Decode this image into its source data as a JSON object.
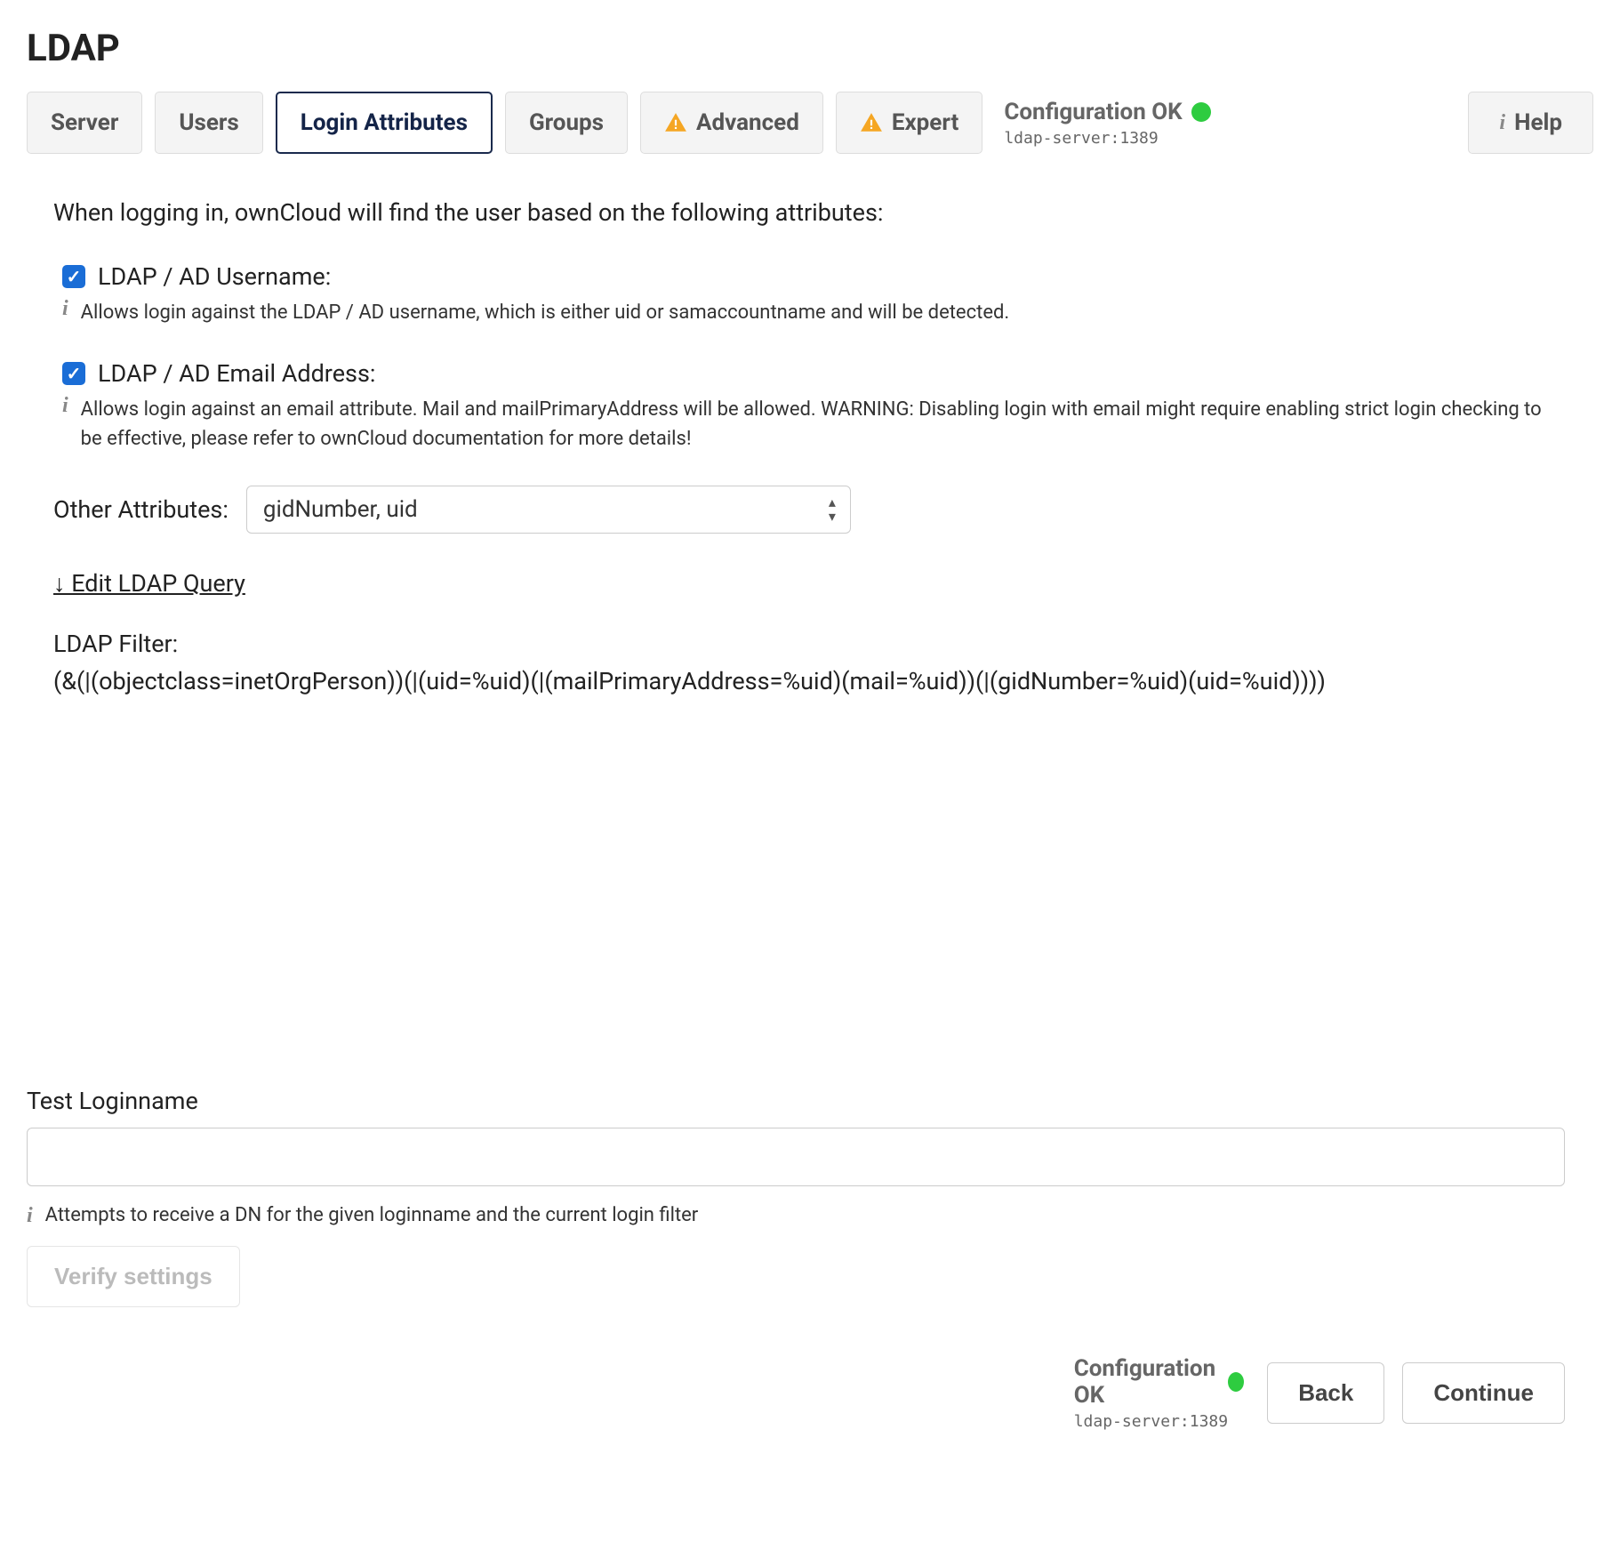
{
  "page_title": "LDAP",
  "tabs": {
    "server": "Server",
    "users": "Users",
    "login_attributes": "Login Attributes",
    "groups": "Groups",
    "advanced": "Advanced",
    "expert": "Expert"
  },
  "status": {
    "label": "Configuration OK",
    "detail": "ldap-server:1389"
  },
  "help_label": "Help",
  "intro": "When logging in, ownCloud will find the user based on the following attributes:",
  "username_check": {
    "label": "LDAP / AD Username:",
    "help": "Allows login against the LDAP / AD username, which is either uid or samaccountname and will be detected."
  },
  "email_check": {
    "label": "LDAP / AD Email Address:",
    "help": "Allows login against an email attribute. Mail and mailPrimaryAddress will be allowed. WARNING: Disabling login with email might require enabling strict login checking to be effective, please refer to ownCloud documentation for more details!"
  },
  "other_attributes": {
    "label": "Other Attributes:",
    "value": "gidNumber, uid"
  },
  "edit_query": "↓ Edit LDAP Query",
  "filter": {
    "label": "LDAP Filter:",
    "value": "(&(|(objectclass=inetOrgPerson))(|(uid=%uid)(|(mailPrimaryAddress=%uid)(mail=%uid))(|(gidNumber=%uid)(uid=%uid))))"
  },
  "test": {
    "label": "Test Loginname",
    "value": "",
    "help": "Attempts to receive a DN for the given loginname and the current login filter",
    "verify_label": "Verify settings"
  },
  "footer": {
    "back": "Back",
    "continue": "Continue"
  }
}
